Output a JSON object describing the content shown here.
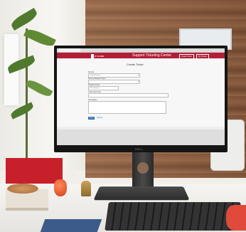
{
  "screen": {
    "site_title": "Support Ticketing Center",
    "logo_text": "IT CARE",
    "header_buttons": [
      "Create Ticket",
      "My Tickets"
    ],
    "page_heading": "Create Ticket",
    "fields": [
      {
        "label": "Service",
        "value": "Cradle Services"
      },
      {
        "label": "Service Request Type",
        "value": ""
      },
      {
        "label": "Support Group",
        "value": "CCO Services"
      },
      {
        "label": "Ticket Summary",
        "value": ""
      },
      {
        "label": "Description",
        "value": ""
      }
    ],
    "submit_label": "Submit",
    "cancel_label": "Cancel",
    "footer_text": ""
  },
  "monitor_brand": "DELL",
  "colors": {
    "header_red": "#b11f37",
    "button_blue": "#2f6fb0",
    "wood": "#8a5a3c",
    "planter_red": "#c8202a"
  }
}
